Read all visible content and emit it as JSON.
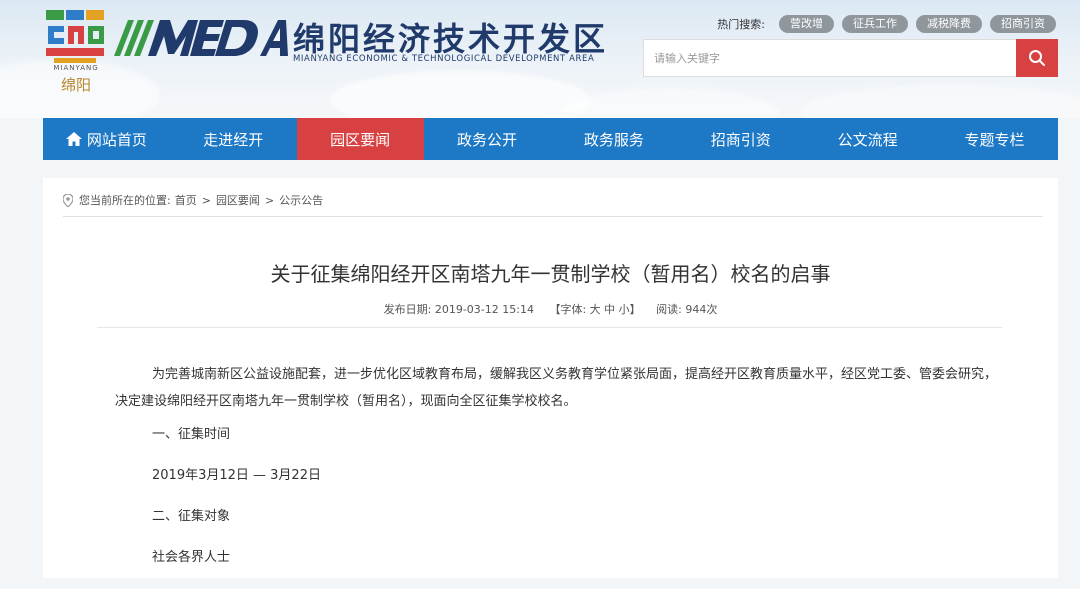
{
  "brand": {
    "emblem_sub": "MIANYANG",
    "emblem_cn": "绵阳",
    "name_cn": "绵阳经济技术开发区",
    "name_en": "MIANYANG ECONOMIC & TECHNOLOGICAL DEVELOPMENT AREA",
    "logo_text": "MEDA",
    "colors": {
      "navy": "#1f3a6b",
      "green": "#3a9b46",
      "red": "#d84141",
      "blue": "#1d78c6"
    }
  },
  "hot_search": {
    "label": "热门搜索:",
    "tags": [
      "营改增",
      "征兵工作",
      "减税降费",
      "招商引资"
    ]
  },
  "search": {
    "placeholder": "请输入关键字",
    "button_icon": "search-icon"
  },
  "nav": {
    "items": [
      {
        "label": "网站首页",
        "icon": "home-icon"
      },
      {
        "label": "走进经开"
      },
      {
        "label": "园区要闻",
        "active": true
      },
      {
        "label": "政务公开"
      },
      {
        "label": "政务服务"
      },
      {
        "label": "招商引资"
      },
      {
        "label": "公文流程"
      },
      {
        "label": "专题专栏"
      }
    ]
  },
  "breadcrumb": {
    "prefix": "您当前所在的位置:",
    "items": [
      "首页",
      "园区要闻",
      "公示公告"
    ],
    "separator": ">",
    "icon": "location-pin-icon"
  },
  "article": {
    "title": "关于征集绵阳经开区南塔九年一贯制学校（暂用名）校名的启事",
    "meta": {
      "date": "发布日期: 2019-03-12 15:14",
      "font_size": "【字体: 大 中 小】",
      "views": "阅读: 944次"
    },
    "paragraph": "为完善城南新区公益设施配套，进一步优化区域教育布局，缓解我区义务教育学位紧张局面，提高经开区教育质量水平，经区党工委、管委会研究，决定建设绵阳经开区南塔九年一贯制学校（暂用名），现面向全区征集学校校名。",
    "lines": [
      "一、征集时间",
      "2019年3月12日 — 3月22日",
      "二、征集对象",
      "社会各界人士"
    ]
  }
}
